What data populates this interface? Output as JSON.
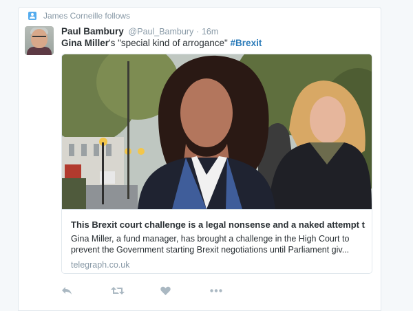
{
  "context": {
    "text": "James Corneille follows",
    "icon": "follow-icon"
  },
  "tweet": {
    "author_name": "Paul Bambury",
    "author_handle": "@Paul_Bambury",
    "separator": "·",
    "time": "16m",
    "text_bold": "Gina Miller",
    "text_rest": "'s \"special kind of arrogance\" ",
    "hashtag": "#Brexit"
  },
  "card": {
    "title": "This Brexit court challenge is a legal nonsense and a naked attempt t...",
    "description_line1": "Gina Miller, a fund manager, has brought a challenge in the High Court to",
    "description_line2": "prevent the Government starting Brexit negotiations until Parliament giv...",
    "domain": "telegraph.co.uk"
  },
  "actions": [
    {
      "icon": "reply-icon"
    },
    {
      "icon": "retweet-icon"
    },
    {
      "icon": "like-icon"
    },
    {
      "icon": "more-icon"
    }
  ],
  "colors": {
    "accent": "#2b7bb9",
    "muted": "#8899a6",
    "text": "#292f33",
    "icon_blue": "#55acee",
    "action_icon": "#aab8c2"
  }
}
